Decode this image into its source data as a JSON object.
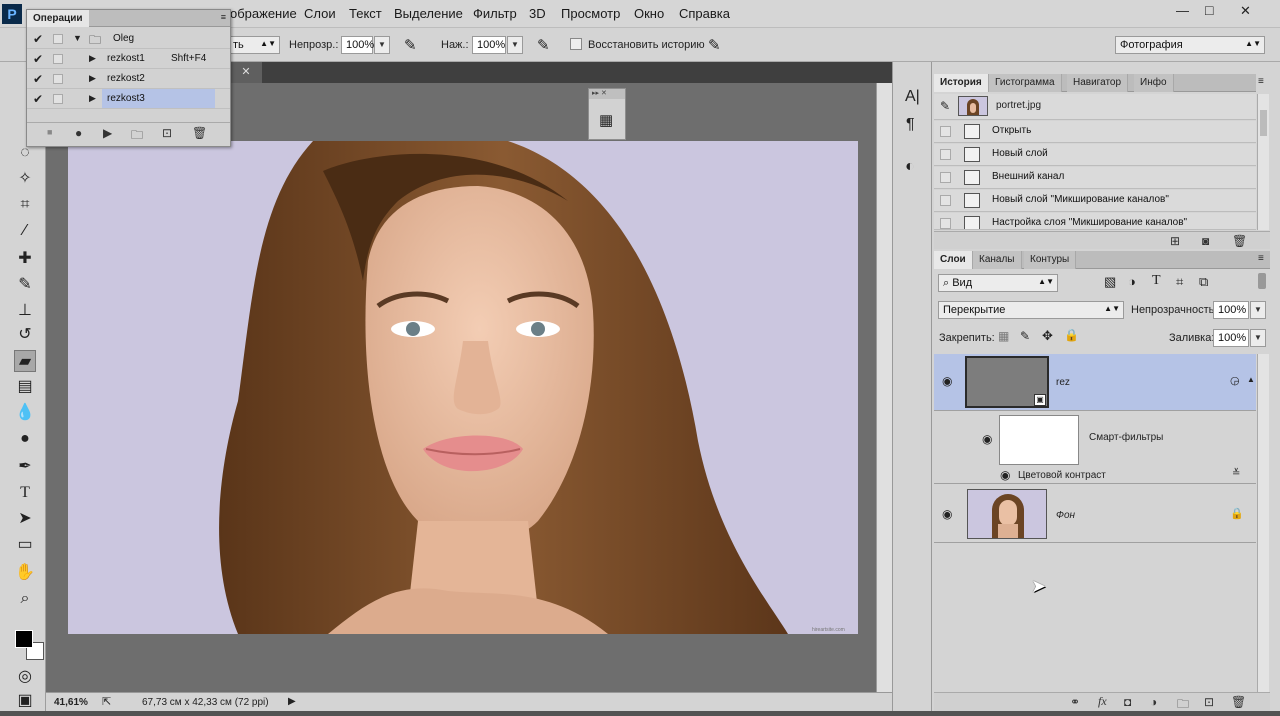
{
  "app": {
    "logo_letter": "P"
  },
  "menu": [
    "ображение",
    "Слои",
    "Текст",
    "Выделение",
    "Фильтр",
    "3D",
    "Просмотр",
    "Окно",
    "Справка"
  ],
  "window_controls": {
    "minimize": "—",
    "maximize": "□",
    "close": "✕"
  },
  "options": {
    "dropdown_partial": "ть",
    "opacity_label": "Непрозр.:",
    "opacity_value": "100%",
    "pressure_label": "Наж.:",
    "pressure_value": "100%",
    "restore_history_label": "Восстановить историю",
    "workspace_value": "Фотография"
  },
  "doc_tab": {
    "close": "✕"
  },
  "actions_panel": {
    "title": "Операции",
    "set_name": "Oleg",
    "items": [
      {
        "name": "rezkost1",
        "shortcut": "Shft+F4"
      },
      {
        "name": "rezkost2",
        "shortcut": ""
      },
      {
        "name": "rezkost3",
        "shortcut": ""
      }
    ]
  },
  "statusbar": {
    "zoom": "41,61%",
    "doc_info": "67,73 см x 42,33 см (72 ppi)"
  },
  "history_panel": {
    "tabs": [
      "История",
      "Гистограмма",
      "Навигатор",
      "Инфо"
    ],
    "snapshot_name": "portret.jpg",
    "states": [
      "Открыть",
      "Новый слой",
      "Внешний канал",
      "Новый слой \"Микширование каналов\"",
      "Настройка слоя \"Микширование каналов\""
    ]
  },
  "layers_panel": {
    "tabs": [
      "Слои",
      "Каналы",
      "Контуры"
    ],
    "filter_value": "Вид",
    "blend_mode": "Перекрытие",
    "opacity_label": "Непрозрачность:",
    "opacity_value": "100%",
    "lock_label": "Закрепить:",
    "fill_label": "Заливка:",
    "fill_value": "100%",
    "layers": [
      {
        "name": "rez",
        "selected": true
      },
      {
        "name": "Смарт-фильтры"
      },
      {
        "name": "Цветовой контраст"
      },
      {
        "name": "Фон"
      }
    ]
  },
  "photo_watermark": "hireartsite.com",
  "colors": {
    "selection": "#b5c3e6",
    "canvas_bg": "#cbc6df",
    "hair": "#6b4424"
  }
}
